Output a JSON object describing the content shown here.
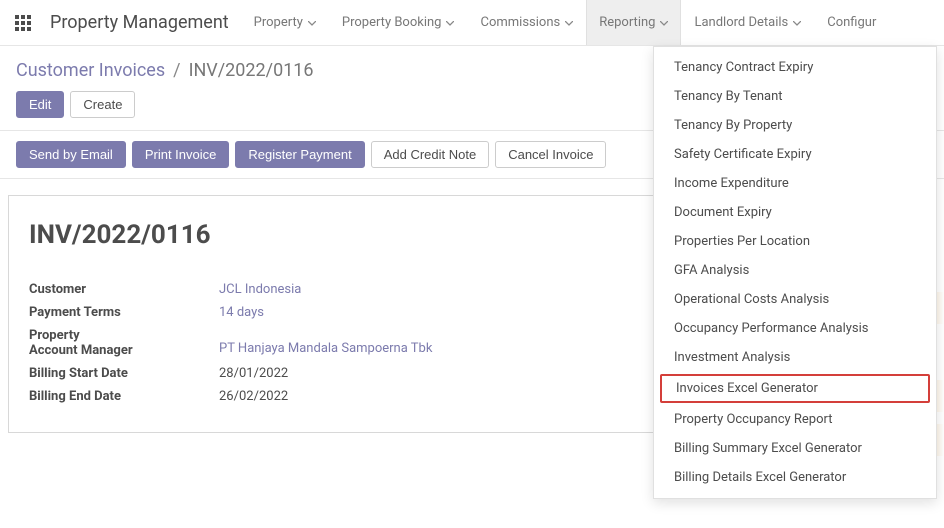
{
  "navbar": {
    "brand": "Property Management",
    "items": [
      {
        "label": "Property"
      },
      {
        "label": "Property Booking"
      },
      {
        "label": "Commissions"
      },
      {
        "label": "Reporting",
        "active": true
      },
      {
        "label": "Landlord Details"
      },
      {
        "label": "Configur"
      }
    ]
  },
  "breadcrumb": {
    "root": "Customer Invoices",
    "sep": "/",
    "current": "INV/2022/0116"
  },
  "cp_buttons": {
    "edit": "Edit",
    "create": "Create"
  },
  "statusbar": {
    "send_by_email": "Send by Email",
    "print_invoice": "Print Invoice",
    "register_payment": "Register Payment",
    "add_credit_note": "Add Credit Note",
    "cancel_invoice": "Cancel Invoice"
  },
  "sheet": {
    "title": "INV/2022/0116",
    "fields": {
      "customer_label": "Customer",
      "customer_value": "JCL Indonesia",
      "payment_terms_label": "Payment Terms",
      "payment_terms_value": "14 days",
      "property_am_label_1": "Property",
      "property_am_label_2": "Account Manager",
      "property_am_value": "PT Hanjaya Mandala Sampoerna Tbk",
      "billing_start_label": "Billing Start Date",
      "billing_start_value": "28/01/2022",
      "billing_end_label": "Billing End Date",
      "billing_end_value": "26/02/2022"
    }
  },
  "dropdown": {
    "items": [
      "Tenancy Contract Expiry",
      "Tenancy By Tenant",
      "Tenancy By Property",
      "Safety Certificate Expiry",
      "Income Expenditure",
      "Document Expiry",
      "Properties Per Location",
      "GFA Analysis",
      "Operational Costs Analysis",
      "Occupancy Performance Analysis",
      "Investment Analysis",
      "Invoices Excel Generator",
      "Property Occupancy Report",
      "Billing Summary Excel Generator",
      "Billing Details Excel Generator"
    ],
    "highlighted_index": 11
  }
}
